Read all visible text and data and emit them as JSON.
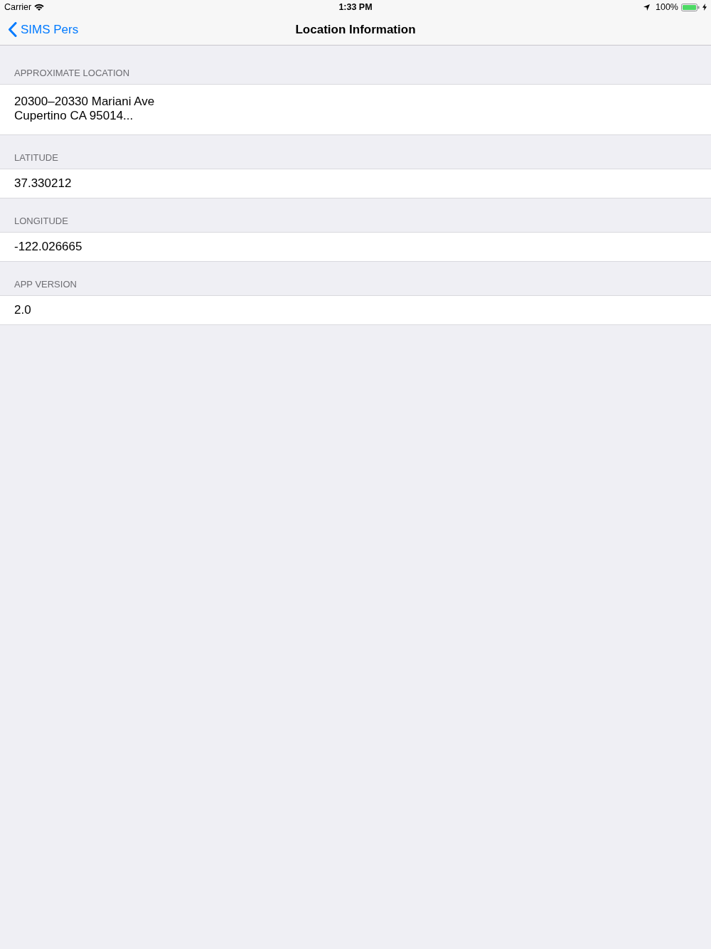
{
  "status_bar": {
    "carrier": "Carrier",
    "time": "1:33 PM",
    "battery": "100%"
  },
  "nav_bar": {
    "back_label": "SIMS Pers",
    "title": "Location Information"
  },
  "sections": [
    {
      "header": "APPROXIMATE LOCATION",
      "lines": [
        "20300–20330 Mariani Ave",
        "Cupertino CA 95014..."
      ]
    },
    {
      "header": "LATITUDE",
      "lines": [
        "37.330212"
      ]
    },
    {
      "header": "LONGITUDE",
      "lines": [
        "-122.026665"
      ]
    },
    {
      "header": "APP VERSION",
      "lines": [
        "2.0"
      ]
    }
  ]
}
